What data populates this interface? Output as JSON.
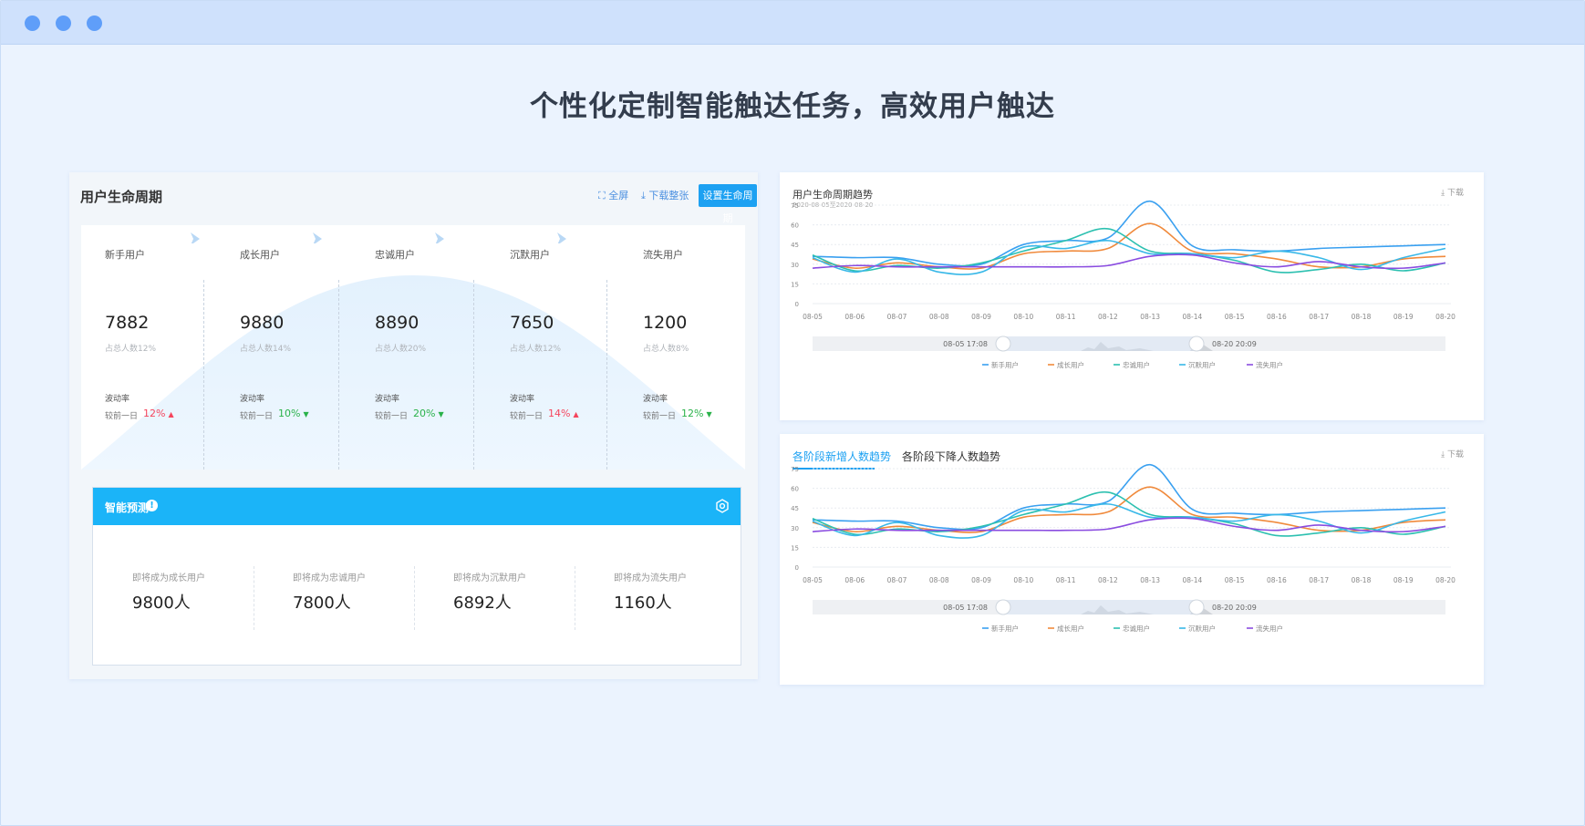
{
  "headline": "个性化定制智能触达任务，高效用户触达",
  "left_panel": {
    "title": "用户生命周期",
    "fullscreen": "全屏",
    "download_all": "下载整张",
    "set_lifecycle": "设置生命周期",
    "rate_label": "波动率",
    "compare_label": "较前一日",
    "stages": [
      {
        "name": "新手用户",
        "value": "7882",
        "pct": "占总人数12%",
        "change": "12%",
        "dir": "up"
      },
      {
        "name": "成长用户",
        "value": "9880",
        "pct": "占总人数14%",
        "change": "10%",
        "dir": "down"
      },
      {
        "name": "忠诚用户",
        "value": "8890",
        "pct": "占总人数20%",
        "change": "20%",
        "dir": "down"
      },
      {
        "name": "沉默用户",
        "value": "7650",
        "pct": "占总人数12%",
        "change": "14%",
        "dir": "up"
      },
      {
        "name": "流失用户",
        "value": "1200",
        "pct": "占总人数8%",
        "change": "12%",
        "dir": "down"
      }
    ]
  },
  "prediction": {
    "title": "智能预测",
    "info": "!",
    "items": [
      {
        "label": "即将成为成长用户",
        "value": "9800人"
      },
      {
        "label": "即将成为忠诚用户",
        "value": "7800人"
      },
      {
        "label": "即将成为沉默用户",
        "value": "6892人"
      },
      {
        "label": "即将成为流失用户",
        "value": "1160人"
      }
    ]
  },
  "chart1_panel": {
    "title": "用户生命周期趋势",
    "subtitle": "2020-08-05至2020-08-20",
    "download": "下载"
  },
  "chart2_panel": {
    "tab_active": "各阶段新增人数趋势",
    "tab_other": "各阶段下降人数趋势",
    "download": "下载"
  },
  "chart_data": [
    {
      "type": "line",
      "x": [
        "08-05",
        "08-06",
        "08-07",
        "08-08",
        "08-09",
        "08-10",
        "08-11",
        "08-12",
        "08-13",
        "08-14",
        "08-15",
        "08-16",
        "08-17",
        "08-18",
        "08-19",
        "08-20"
      ],
      "ylim": [
        0,
        75
      ],
      "yticks": [
        "0",
        "15",
        "30",
        "45",
        "60",
        "75"
      ],
      "grid": true,
      "legend": "bottom",
      "range_start": "08-05 17:08",
      "range_end": "08-20 20:09",
      "series": [
        {
          "name": "新手用户",
          "color": "#3aa0f0",
          "values": [
            36,
            35,
            35,
            30,
            30,
            45,
            48,
            50,
            78,
            44,
            41,
            40,
            42,
            43,
            44,
            45
          ]
        },
        {
          "name": "成长用户",
          "color": "#f08a3c",
          "values": [
            34,
            27,
            31,
            28,
            27,
            38,
            40,
            42,
            61,
            40,
            38,
            34,
            28,
            28,
            34,
            36
          ]
        },
        {
          "name": "忠诚用户",
          "color": "#2cc0b0",
          "values": [
            37,
            25,
            29,
            27,
            31,
            40,
            48,
            57,
            40,
            38,
            33,
            24,
            26,
            30,
            25,
            31
          ]
        },
        {
          "name": "沉默用户",
          "color": "#38b8e8",
          "values": [
            35,
            24,
            34,
            24,
            24,
            43,
            42,
            48,
            38,
            38,
            35,
            40,
            35,
            26,
            35,
            42
          ]
        },
        {
          "name": "流失用户",
          "color": "#8a4ce0",
          "values": [
            27,
            29,
            28,
            28,
            28,
            28,
            28,
            29,
            36,
            37,
            31,
            28,
            32,
            28,
            27,
            31
          ]
        }
      ]
    },
    {
      "type": "line",
      "x": [
        "08-05",
        "08-06",
        "08-07",
        "08-08",
        "08-09",
        "08-10",
        "08-11",
        "08-12",
        "08-13",
        "08-14",
        "08-15",
        "08-16",
        "08-17",
        "08-18",
        "08-19",
        "08-20"
      ],
      "ylim": [
        0,
        75
      ],
      "yticks": [
        "0",
        "15",
        "30",
        "45",
        "60",
        "75"
      ],
      "grid": true,
      "legend": "bottom",
      "range_start": "08-05 17:08",
      "range_end": "08-20 20:09",
      "series": [
        {
          "name": "新手用户",
          "color": "#3aa0f0",
          "values": [
            36,
            35,
            35,
            30,
            30,
            45,
            48,
            50,
            78,
            44,
            41,
            40,
            42,
            43,
            44,
            45
          ]
        },
        {
          "name": "成长用户",
          "color": "#f08a3c",
          "values": [
            34,
            27,
            31,
            28,
            27,
            38,
            40,
            42,
            61,
            40,
            38,
            34,
            28,
            28,
            34,
            36
          ]
        },
        {
          "name": "忠诚用户",
          "color": "#2cc0b0",
          "values": [
            37,
            25,
            29,
            27,
            31,
            40,
            48,
            57,
            40,
            38,
            33,
            24,
            26,
            30,
            25,
            31
          ]
        },
        {
          "name": "沉默用户",
          "color": "#38b8e8",
          "values": [
            35,
            24,
            34,
            24,
            24,
            43,
            42,
            48,
            38,
            38,
            35,
            40,
            35,
            26,
            35,
            42
          ]
        },
        {
          "name": "流失用户",
          "color": "#8a4ce0",
          "values": [
            27,
            29,
            28,
            28,
            28,
            28,
            28,
            29,
            36,
            37,
            31,
            28,
            32,
            28,
            27,
            31
          ]
        }
      ]
    }
  ]
}
